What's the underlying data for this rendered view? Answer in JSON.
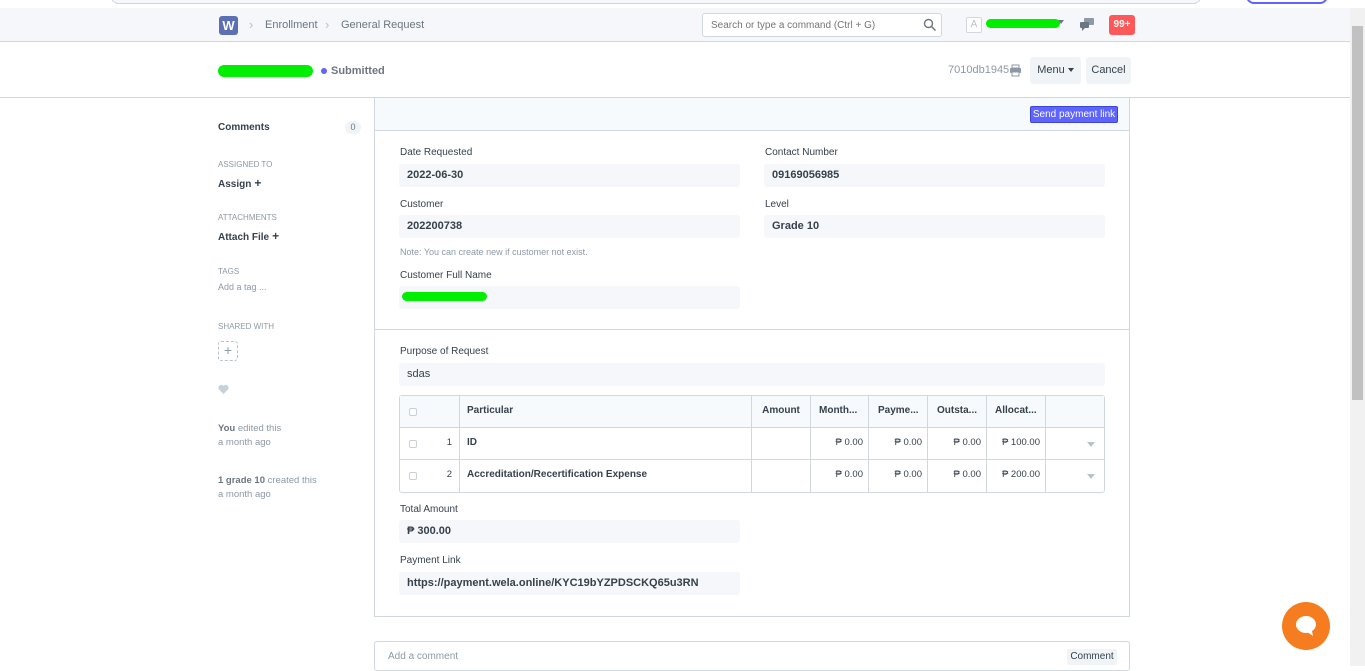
{
  "navbar": {
    "logo_letter": "W",
    "breadcrumbs": [
      "Enrollment",
      "General Request"
    ],
    "search_placeholder": "Search or type a command (Ctrl + G)",
    "avatar_letter": "A",
    "notifications": "99+"
  },
  "doc": {
    "status": "Submitted",
    "status_color": "#5e64ff",
    "id": "7010db1945",
    "menu_label": "Menu",
    "cancel_label": "Cancel",
    "send_link_label": "Send payment link"
  },
  "sidebar": {
    "comments_label": "Comments",
    "comments_count": "0",
    "assigned_label": "ASSIGNED TO",
    "assign_action": "Assign",
    "attachments_label": "ATTACHMENTS",
    "attach_action": "Attach File",
    "tags_label": "TAGS",
    "tag_placeholder": "Add a tag ...",
    "shared_label": "SHARED WITH",
    "activity": [
      {
        "who": "You",
        "what": "edited this",
        "when": "a month ago"
      },
      {
        "who": "1 grade 10",
        "what": "created this",
        "when": "a month ago"
      }
    ]
  },
  "fields": {
    "date_requested": {
      "label": "Date Requested",
      "value": "2022-06-30"
    },
    "contact_number": {
      "label": "Contact Number",
      "value": "09169056985"
    },
    "customer": {
      "label": "Customer",
      "value": "202200738",
      "note": "Note: You can create new if customer not exist."
    },
    "level": {
      "label": "Level",
      "value": "Grade 10"
    },
    "customer_full_name": {
      "label": "Customer Full Name"
    },
    "purpose": {
      "label": "Purpose of Request",
      "value": "sdas"
    },
    "total_amount": {
      "label": "Total Amount",
      "value": "₱ 300.00"
    },
    "payment_link": {
      "label": "Payment Link",
      "value": "https://payment.wela.online/KYC19bYZPDSCKQ65u3RN"
    }
  },
  "table": {
    "headers": [
      "Particular",
      "Amount",
      "Month...",
      "Payme...",
      "Outsta...",
      "Allocat..."
    ],
    "rows": [
      {
        "idx": "1",
        "particular": "ID",
        "amount": "",
        "monthly": "₱ 0.00",
        "payment": "₱ 0.00",
        "outstanding": "₱ 0.00",
        "allocated": "₱ 100.00"
      },
      {
        "idx": "2",
        "particular": "Accreditation/Recertification Expense",
        "amount": "",
        "monthly": "₱ 0.00",
        "payment": "₱ 0.00",
        "outstanding": "₱ 0.00",
        "allocated": "₱ 200.00"
      }
    ]
  },
  "comment": {
    "placeholder": "Add a comment",
    "button": "Comment"
  }
}
